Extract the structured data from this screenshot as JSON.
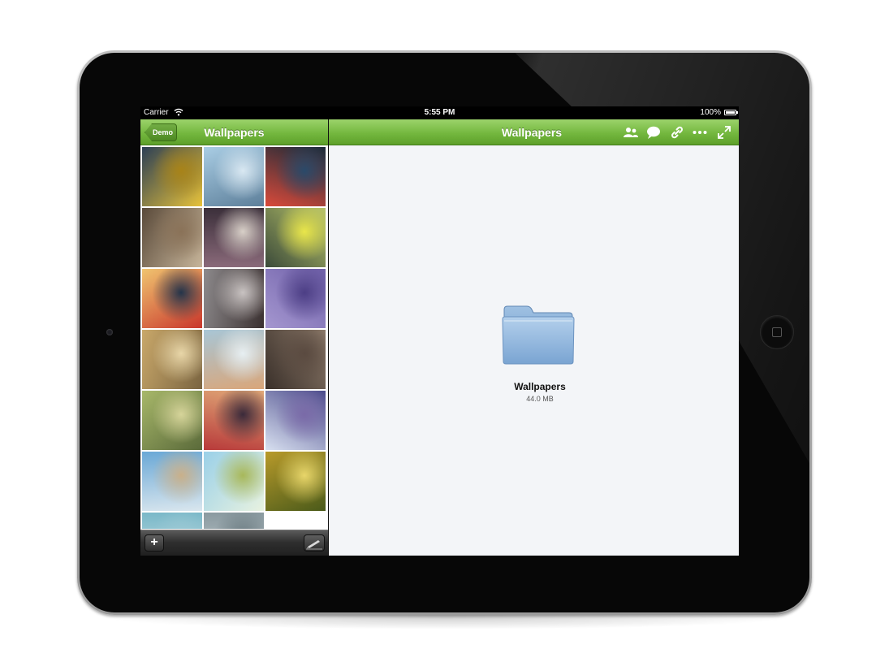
{
  "status_bar": {
    "carrier": "Carrier",
    "time": "5:55 PM",
    "battery": "100%"
  },
  "left_pane": {
    "back_label": "Demo",
    "title": "Wallpapers",
    "add_label": "+",
    "thumbnails": [
      {
        "name": "yellow-rope",
        "colors": [
          "#2c3f55",
          "#e7c23a",
          "#a88318"
        ]
      },
      {
        "name": "blue-branches",
        "colors": [
          "#a9cde4",
          "#5d7f9a",
          "#d9e8f2"
        ]
      },
      {
        "name": "traffic-light",
        "colors": [
          "#1a2a38",
          "#d94a3a",
          "#2a4a6a"
        ]
      },
      {
        "name": "chipmunk",
        "colors": [
          "#5a4a3a",
          "#c7b59a",
          "#8a7258"
        ]
      },
      {
        "name": "toy-bike",
        "colors": [
          "#3b2f3a",
          "#8a6a7a",
          "#d8d0c8"
        ]
      },
      {
        "name": "green-sign",
        "colors": [
          "#3b4a3a",
          "#b8c46a",
          "#e9e64a"
        ]
      },
      {
        "name": "red-stripe",
        "colors": [
          "#f0c470",
          "#c9362b",
          "#24344a"
        ]
      },
      {
        "name": "dry-plant",
        "colors": [
          "#8d8a8c",
          "#3a3030",
          "#c9c3c2"
        ]
      },
      {
        "name": "purple-blur",
        "colors": [
          "#6e5fa8",
          "#a597d0",
          "#4c3e85"
        ]
      },
      {
        "name": "golden-grass",
        "colors": [
          "#c9a86a",
          "#7a6440",
          "#e8d6a8"
        ]
      },
      {
        "name": "blossom",
        "colors": [
          "#a8c6d6",
          "#d9a67a",
          "#e7eff2"
        ]
      },
      {
        "name": "wood-log",
        "colors": [
          "#3a302a",
          "#8a7868",
          "#5a4a40"
        ]
      },
      {
        "name": "moss",
        "colors": [
          "#a8b86a",
          "#5a6a3a",
          "#d6d49a"
        ]
      },
      {
        "name": "red-bokeh",
        "colors": [
          "#e0a878",
          "#b83a3a",
          "#3a2a3a"
        ]
      },
      {
        "name": "blue-ice",
        "colors": [
          "#4a4a8a",
          "#d8e0f0",
          "#7a6aa8"
        ]
      },
      {
        "name": "sky-blur",
        "colors": [
          "#6aa8d6",
          "#d9e6ee",
          "#c9b08a"
        ]
      },
      {
        "name": "willow-bud",
        "colors": [
          "#9ad0e8",
          "#e8f2e0",
          "#a8b85a"
        ]
      },
      {
        "name": "yellow-blur",
        "colors": [
          "#b89a2a",
          "#4a5a1a",
          "#e8d66a"
        ]
      },
      {
        "name": "teal-partial",
        "colors": [
          "#7ab8c8",
          "#c8e0e6",
          "#9ac8d4"
        ]
      },
      {
        "name": "grey-partial",
        "colors": [
          "#8a9aa0",
          "#c8d2d6",
          "#6a7a80"
        ]
      }
    ]
  },
  "right_pane": {
    "title": "Wallpapers",
    "header_icons": [
      "share-users-icon",
      "comment-icon",
      "link-icon",
      "more-icon",
      "fullscreen-icon"
    ],
    "folder_name": "Wallpapers",
    "folder_size": "44.0 MB"
  },
  "colors": {
    "accent_green": "#74b83f",
    "folder_blue": "#8fb3db"
  }
}
